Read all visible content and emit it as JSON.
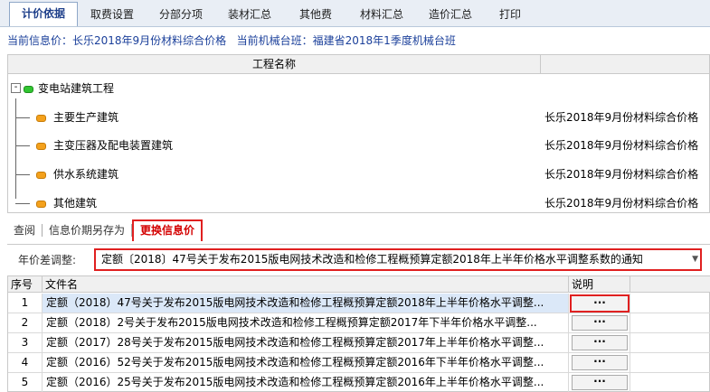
{
  "tabs": [
    {
      "label": "计价依据",
      "active": true
    },
    {
      "label": "取费设置",
      "active": false
    },
    {
      "label": "分部分项",
      "active": false
    },
    {
      "label": "装材汇总",
      "active": false
    },
    {
      "label": "其他费",
      "active": false
    },
    {
      "label": "材料汇总",
      "active": false
    },
    {
      "label": "造价汇总",
      "active": false
    },
    {
      "label": "打印",
      "active": false
    }
  ],
  "info": {
    "current_price": "当前信息价：长乐2018年9月份材料综合价格",
    "current_machine": "当前机械台班：福建省2018年1季度机械台班"
  },
  "tree": {
    "column_header": "工程名称",
    "expander": "-",
    "root": {
      "name": "变电站建筑工程"
    },
    "children": [
      {
        "name": "主要生产建筑",
        "price": "长乐2018年9月份材料综合价格"
      },
      {
        "name": "主变压器及配电装置建筑",
        "price": "长乐2018年9月份材料综合价格"
      },
      {
        "name": "供水系统建筑",
        "price": "长乐2018年9月份材料综合价格"
      },
      {
        "name": "其他建筑",
        "price": "长乐2018年9月份材料综合价格"
      }
    ]
  },
  "subtabs": [
    {
      "label": "查阅",
      "active": false
    },
    {
      "label": "信息价期另存为",
      "active": false
    },
    {
      "label": "更换信息价",
      "active": true
    }
  ],
  "year_adjust": {
    "label": "年价差调整:",
    "selected": "定额〔2018〕47号关于发布2015版电网技术改造和检修工程概预算定额2018年上半年价格水平调整系数的通知",
    "arrow": "▼"
  },
  "grid": {
    "headers": {
      "no": "序号",
      "file": "文件名",
      "note": "说明"
    },
    "button_label": "···",
    "rows": [
      {
        "no": "1",
        "file": "定额（2018）47号关于发布2015版电网技术改造和检修工程概预算定额2018年上半年价格水平调整...",
        "selected": true
      },
      {
        "no": "2",
        "file": "定额（2018）2号关于发布2015版电网技术改造和检修工程概预算定额2017年下半年价格水平调整...",
        "selected": false
      },
      {
        "no": "3",
        "file": "定额（2017）28号关于发布2015版电网技术改造和检修工程概预算定额2017年上半年价格水平调整...",
        "selected": false
      },
      {
        "no": "4",
        "file": "定额（2016）52号关于发布2015版电网技术改造和检修工程概预算定额2016年下半年价格水平调整...",
        "selected": false
      },
      {
        "no": "5",
        "file": "定额（2016）25号关于发布2015版电网技术改造和检修工程概预算定额2016年上半年价格水平调整...",
        "selected": false
      }
    ]
  }
}
